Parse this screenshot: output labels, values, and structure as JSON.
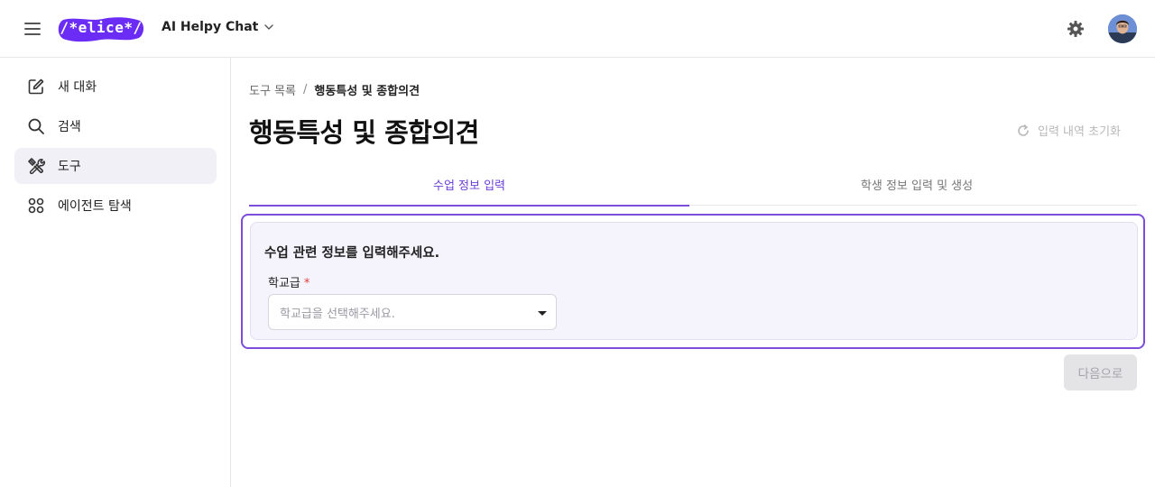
{
  "header": {
    "logo_text": "/*elice*/",
    "app_title": "AI Helpy Chat",
    "brand_color": "#6b2cf5"
  },
  "sidebar": {
    "items": [
      {
        "label": "새 대화",
        "icon": "edit-icon"
      },
      {
        "label": "검색",
        "icon": "search-icon"
      },
      {
        "label": "도구",
        "icon": "tools-icon",
        "active": true
      },
      {
        "label": "에이전트 탐색",
        "icon": "grid-dots-icon"
      }
    ]
  },
  "breadcrumb": {
    "parent": "도구 목록",
    "separator": "/",
    "current": "행동특성 및 종합의견"
  },
  "main": {
    "title": "행동특성 및 종합의견",
    "reset_label": "입력 내역 초기화",
    "tabs": [
      {
        "label": "수업 정보 입력",
        "active": true
      },
      {
        "label": "학생 정보 입력 및 생성",
        "active": false
      }
    ]
  },
  "form": {
    "heading": "수업 관련 정보를 입력해주세요.",
    "school_level": {
      "label": "학교급",
      "required_mark": "*",
      "placeholder": "학교급을 선택해주세요."
    }
  },
  "actions": {
    "next_label": "다음으로"
  },
  "colors": {
    "accent": "#7c4ddb",
    "active_tab_text": "#6b3fd6",
    "required": "#e23b3b"
  }
}
